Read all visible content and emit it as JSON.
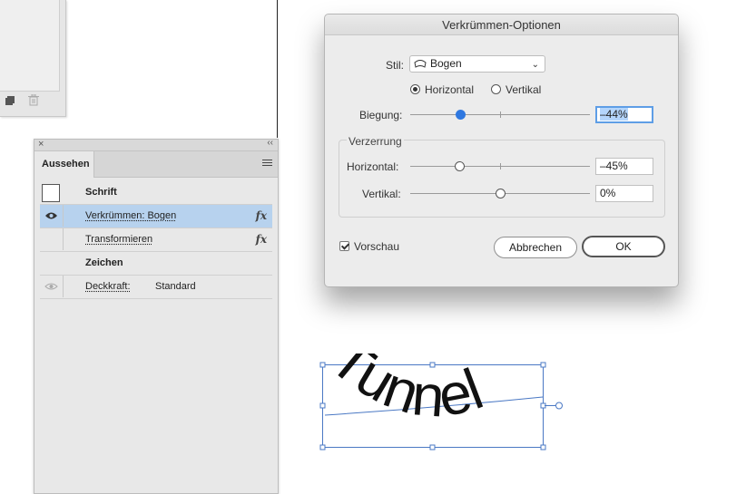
{
  "aussehen_panel": {
    "tab_label": "Aussehen",
    "rows": [
      {
        "label": "Schrift",
        "value": "",
        "fx": ""
      },
      {
        "label": "Verkrümmen: Bogen",
        "value": "",
        "fx": "fx"
      },
      {
        "label": "Transformieren",
        "value": "",
        "fx": "fx"
      },
      {
        "label": "Zeichen",
        "value": "",
        "fx": ""
      },
      {
        "label": "Deckkraft:",
        "value": "Standard",
        "fx": ""
      }
    ]
  },
  "dialog": {
    "title": "Verkrümmen-Optionen",
    "stil_label": "Stil:",
    "stil_value": "Bogen",
    "orientation": {
      "horizontal_label": "Horizontal",
      "vertikal_label": "Vertikal",
      "selected": "Horizontal"
    },
    "biegung": {
      "label": "Biegung:",
      "value_text": "–44%",
      "value": -44
    },
    "verzerrung": {
      "title": "Verzerrung",
      "horizontal": {
        "label": "Horizontal:",
        "value_text": "–45%",
        "value": -45
      },
      "vertikal": {
        "label": "Vertikal:",
        "value_text": "0%",
        "value": 0
      }
    },
    "vorschau_label": "Vorschau",
    "vorschau_checked": true,
    "cancel_label": "Abbrechen",
    "ok_label": "OK"
  },
  "canvas": {
    "text": "Tunnel"
  },
  "colors": {
    "accent": "#2f78e0",
    "selection_row": "#b7d2ee",
    "bounding_box": "#4a78c4"
  }
}
